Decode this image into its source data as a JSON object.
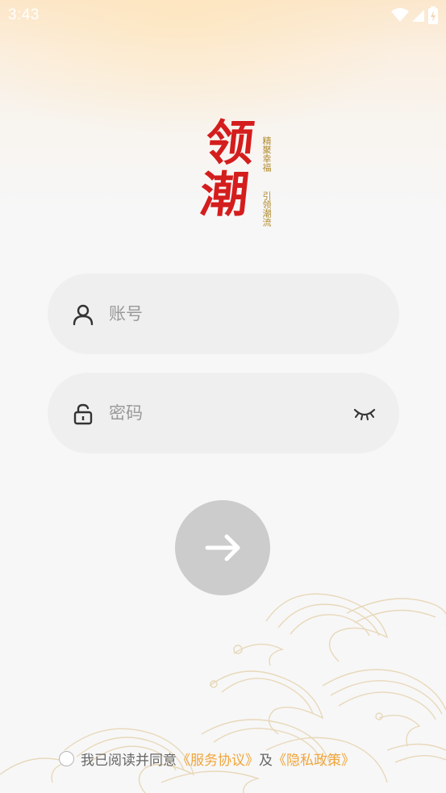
{
  "status_bar": {
    "time": "3:43",
    "icons": [
      "wifi-icon",
      "signal-icon",
      "battery-icon"
    ]
  },
  "logo": {
    "main_text": "领潮",
    "tagline_right": "精聚幸福",
    "tagline_left": "引领潮流"
  },
  "account_field": {
    "placeholder": "账号",
    "value": "",
    "icon": "user-icon"
  },
  "password_field": {
    "placeholder": "密码",
    "value": "",
    "icon": "lock-icon",
    "toggle_icon": "eye-closed-icon"
  },
  "submit": {
    "icon": "arrow-right-icon"
  },
  "agreement": {
    "prefix": "我已阅读并同意",
    "service_link": "《服务协议》",
    "connector": "及",
    "privacy_link": "《隐私政策》",
    "checked": false
  },
  "colors": {
    "brand_red": "#d41d1d",
    "link_orange": "#f0a53a",
    "button_disabled": "#cccccc",
    "field_bg": "#efefef"
  }
}
